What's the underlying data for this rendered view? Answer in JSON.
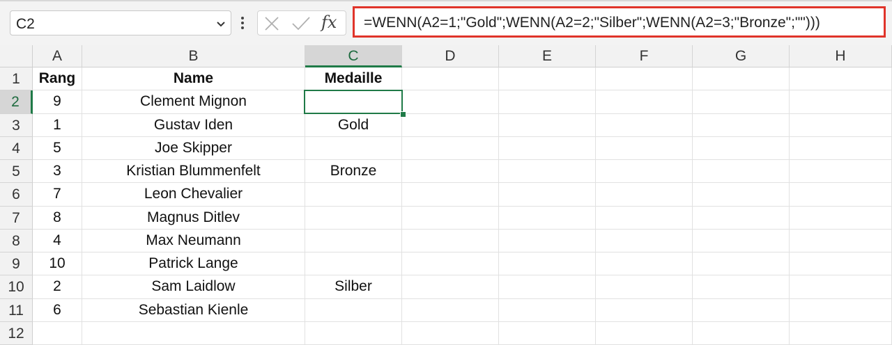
{
  "formula_bar": {
    "name_box": "C2",
    "formula": "=WENN(A2=1;\"Gold\";WENN(A2=2;\"Silber\";WENN(A2=3;\"Bronze\";\"\")))",
    "cancel_icon": "close-icon",
    "enter_icon": "checkmark-icon",
    "function_label": "fx",
    "highlight_color": "#e0342a"
  },
  "columns": [
    "A",
    "B",
    "C",
    "D",
    "E",
    "F",
    "G",
    "H"
  ],
  "selected_column": "C",
  "selected_row": "2",
  "rows": [
    {
      "num": "1",
      "a": "Rang",
      "b": "Name",
      "c": "Medaille"
    },
    {
      "num": "2",
      "a": "9",
      "b": "Clement Mignon",
      "c": ""
    },
    {
      "num": "3",
      "a": "1",
      "b": "Gustav Iden",
      "c": "Gold"
    },
    {
      "num": "4",
      "a": "5",
      "b": "Joe Skipper",
      "c": ""
    },
    {
      "num": "5",
      "a": "3",
      "b": "Kristian Blummenfelt",
      "c": "Bronze"
    },
    {
      "num": "6",
      "a": "7",
      "b": "Leon Chevalier",
      "c": ""
    },
    {
      "num": "7",
      "a": "8",
      "b": "Magnus Ditlev",
      "c": ""
    },
    {
      "num": "8",
      "a": "4",
      "b": "Max Neumann",
      "c": ""
    },
    {
      "num": "9",
      "a": "10",
      "b": "Patrick Lange",
      "c": ""
    },
    {
      "num": "10",
      "a": "2",
      "b": "Sam Laidlow",
      "c": "Silber"
    },
    {
      "num": "11",
      "a": "6",
      "b": "Sebastian Kienle",
      "c": ""
    },
    {
      "num": "12",
      "a": "",
      "b": "",
      "c": ""
    }
  ],
  "accent_color": "#1f7a47"
}
